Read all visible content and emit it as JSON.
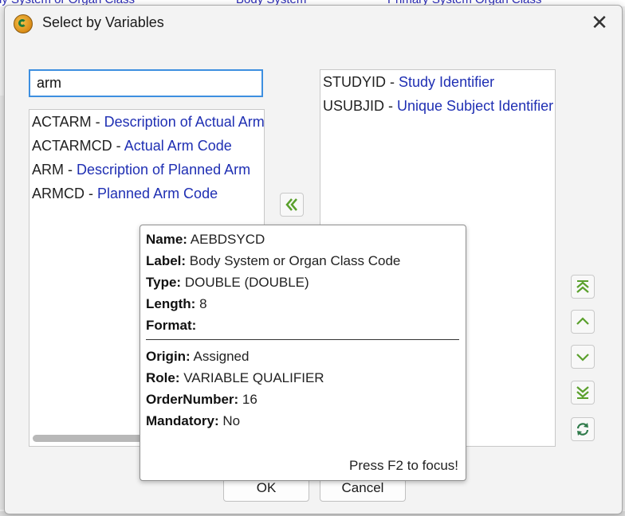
{
  "background": {
    "fragments": [
      "dy System or Organ Class",
      "Body System",
      "Primary System Organ Class"
    ]
  },
  "dialog": {
    "title": "Select by Variables",
    "close_glyph": "✕"
  },
  "search": {
    "value": "arm"
  },
  "left_list": [
    {
      "code": "ACTARM",
      "desc": "Description of Actual Arm"
    },
    {
      "code": "ACTARMCD",
      "desc": "Actual Arm Code"
    },
    {
      "code": "ARM",
      "desc": "Description of Planned Arm"
    },
    {
      "code": "ARMCD",
      "desc": "Planned Arm Code"
    }
  ],
  "right_list": [
    {
      "code": "STUDYID",
      "desc": "Study Identifier"
    },
    {
      "code": "USUBJID",
      "desc": "Unique Subject Identifier"
    }
  ],
  "separator": " - ",
  "icons": {
    "move_left": "double-chevron-left-icon",
    "move_top": "double-chevron-up-icon",
    "move_up": "chevron-up-icon",
    "move_down": "chevron-down-icon",
    "move_bottom": "double-chevron-down-icon",
    "refresh": "refresh-icon"
  },
  "accent_color": "#5aa02c",
  "tooltip": {
    "name_label": "Name:",
    "name_value": "AEBDSYCD",
    "label_label": "Label:",
    "label_value": "Body System or Organ Class Code",
    "type_label": "Type:",
    "type_value": "DOUBLE (DOUBLE)",
    "length_label": "Length:",
    "length_value": "8",
    "format_label": "Format:",
    "format_value": "",
    "origin_label": "Origin:",
    "origin_value": "Assigned",
    "role_label": "Role:",
    "role_value": "VARIABLE QUALIFIER",
    "order_label": "OrderNumber:",
    "order_value": "16",
    "mandatory_label": "Mandatory:",
    "mandatory_value": "No",
    "footer": "Press F2 to focus!"
  },
  "buttons": {
    "ok": "OK",
    "cancel": "Cancel"
  }
}
